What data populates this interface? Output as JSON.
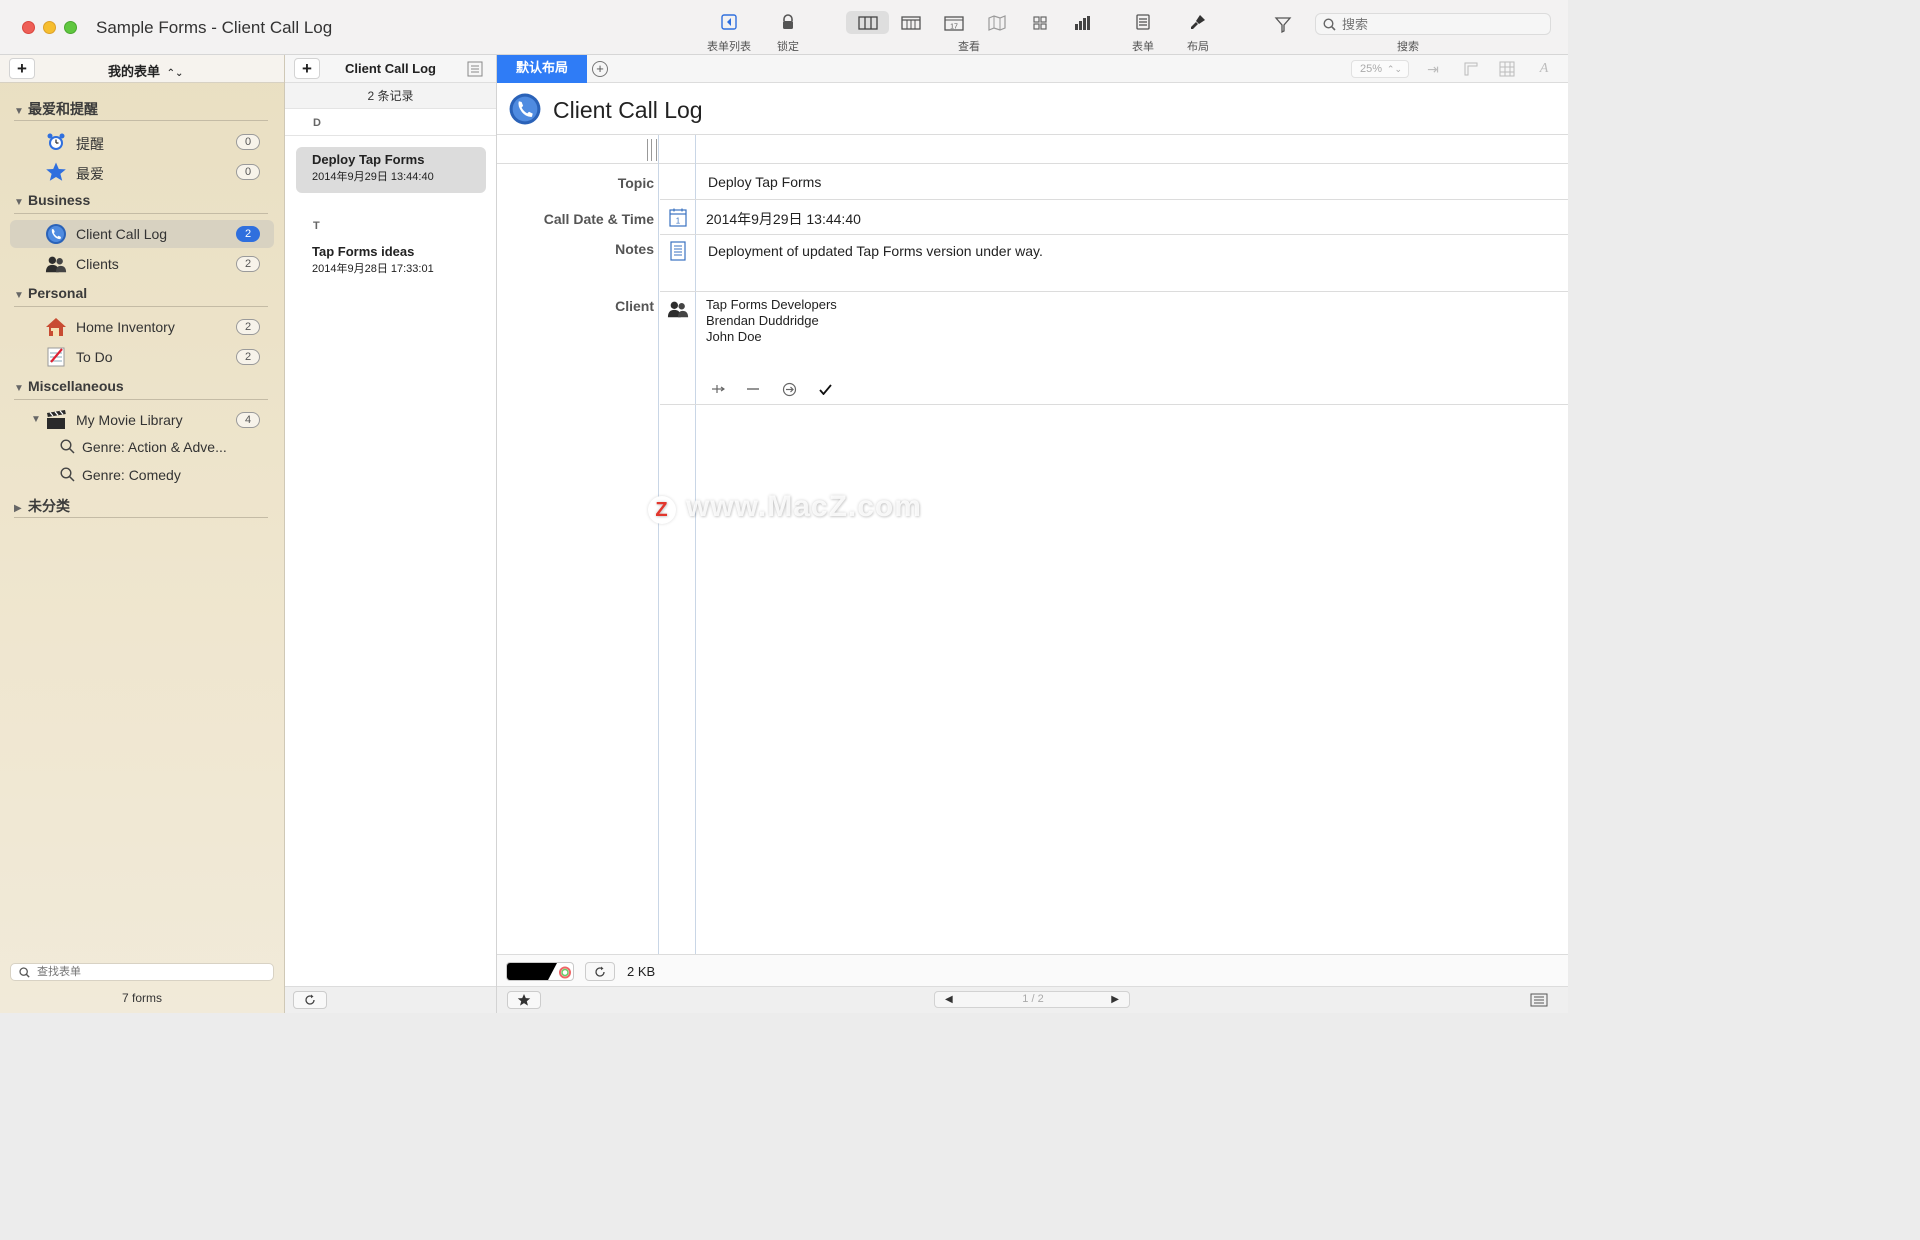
{
  "window": {
    "title": "Sample Forms - Client Call Log"
  },
  "toolbar": {
    "form_list": "表单列表",
    "lock": "锁定",
    "view": "查看",
    "form": "表单",
    "layout": "布局",
    "search_label": "搜索",
    "search_placeholder": "搜索",
    "calendar_day": "17"
  },
  "sidebar": {
    "header_title": "我的表单",
    "sections": {
      "favorites": "最爱和提醒",
      "business": "Business",
      "personal": "Personal",
      "misc": "Miscellaneous",
      "uncategorized": "未分类"
    },
    "items": {
      "reminders": {
        "label": "提醒",
        "count": "0"
      },
      "favorites": {
        "label": "最爱",
        "count": "0"
      },
      "client_call_log": {
        "label": "Client Call Log",
        "count": "2"
      },
      "clients": {
        "label": "Clients",
        "count": "2"
      },
      "home_inventory": {
        "label": "Home Inventory",
        "count": "2"
      },
      "todo": {
        "label": "To Do",
        "count": "2"
      },
      "movie_library": {
        "label": "My Movie Library",
        "count": "4"
      },
      "genre_action": {
        "label": "Genre: Action & Adve..."
      },
      "genre_comedy": {
        "label": "Genre: Comedy"
      }
    },
    "search_placeholder": "查找表单",
    "footer": "7 forms"
  },
  "record_list": {
    "title": "Client Call Log",
    "count": "2 条记录",
    "groups": [
      {
        "letter": "D",
        "title": "Deploy Tap Forms",
        "date": "2014年9月29日 13:44:40"
      },
      {
        "letter": "T",
        "title": "Tap Forms ideas",
        "date": "2014年9月28日 17:33:01"
      }
    ]
  },
  "detail": {
    "tab_default": "默认布局",
    "zoom": "25%",
    "form_title": "Client Call Log",
    "fields": {
      "topic": {
        "label": "Topic",
        "value": "Deploy Tap Forms"
      },
      "call_date": {
        "label": "Call Date & Time",
        "value": "2014年9月29日 13:44:40"
      },
      "notes": {
        "label": "Notes",
        "value": "Deployment of updated Tap Forms version under way."
      },
      "client": {
        "label": "Client",
        "values": [
          "Tap Forms Developers",
          "Brendan Duddridge",
          "John Doe"
        ]
      }
    },
    "file_size": "2 KB",
    "pager": "1 / 2"
  },
  "watermark": {
    "badge": "Z",
    "text": "www.MacZ.com"
  },
  "colors": {
    "accent": "#2f7cf6",
    "badge_blue": "#2f6fde",
    "sidebar": "#e9dfc2"
  }
}
